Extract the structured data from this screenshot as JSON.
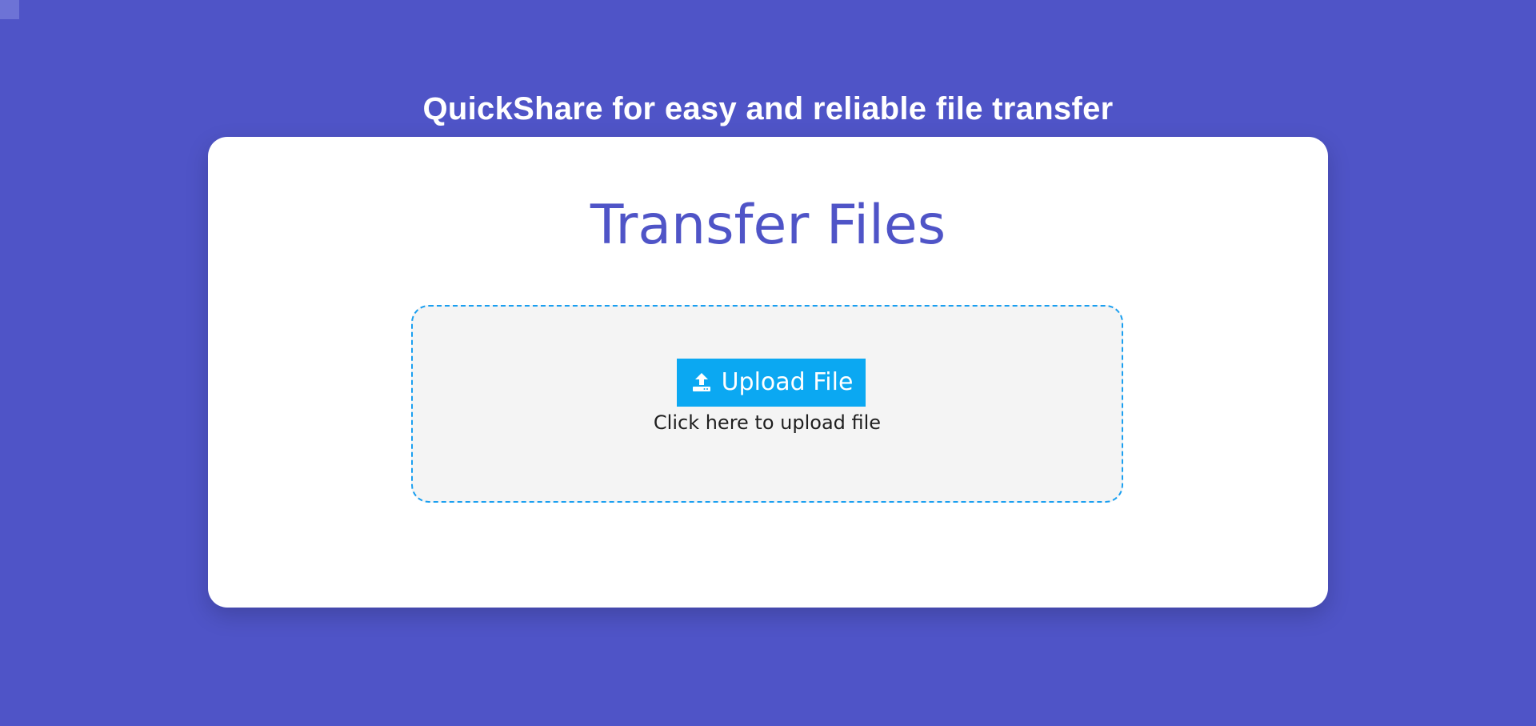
{
  "header": {
    "tagline": "QuickShare for easy and reliable file transfer"
  },
  "card": {
    "title": "Transfer Files"
  },
  "upload": {
    "button_label": "Upload File",
    "button_icon": "upload-icon",
    "hint": "Click here to upload file"
  },
  "colors": {
    "background": "#4f54c7",
    "title": "#4f54c7",
    "button": "#0ba8f2",
    "drop_border": "#1a9ff0",
    "drop_background": "#f4f4f4"
  }
}
